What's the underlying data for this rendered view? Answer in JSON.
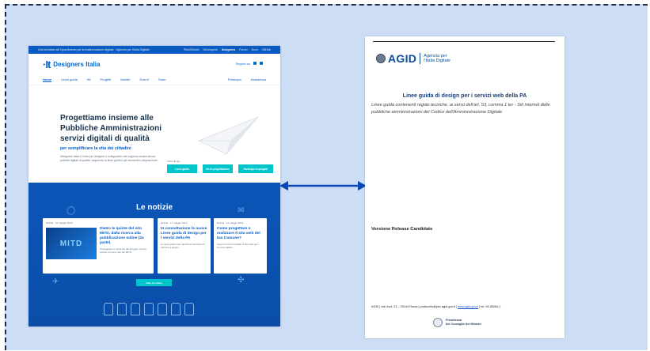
{
  "colors": {
    "background": "#cdddf5",
    "arrow": "#0a4ab8",
    "brand_blue": "#0066cc",
    "news_blue": "#0b56b8",
    "cta_teal": "#00c5ca",
    "agid_blue": "#0a4d9c"
  },
  "site": {
    "topbar_left": "Una iniziativa del Dipartimento per la trasformazione digitale · Agenzia per l'Italia Digitale",
    "topbar_links": [
      {
        "label": "Plus/Stream",
        "active": false
      },
      {
        "label": "Developers",
        "active": false
      },
      {
        "label": "Designers",
        "active": true
      },
      {
        "label": "Forum",
        "active": false
      },
      {
        "label": "Docs",
        "active": false
      },
      {
        "label": "GitHub",
        "active": false
      }
    ],
    "logo_mark": "·It",
    "logo_name": "Designers Italia",
    "social_label": "Seguici su",
    "nav": [
      {
        "label": "Home",
        "active": true
      },
      {
        "label": "Linee guida",
        "active": false
      },
      {
        "label": "Kit",
        "active": false
      },
      {
        "label": "Progetti",
        "active": false
      },
      {
        "label": "Notizie",
        "active": false
      },
      {
        "label": "Eventi",
        "active": false
      },
      {
        "label": "Team",
        "active": false
      }
    ],
    "nav_right": [
      "Partecipa",
      "Assistenza"
    ],
    "hero": {
      "title": "Progettiamo insieme alle Pubbliche Amministrazioni servizi digitali di qualità",
      "subtitle": "per semplificare la vita dei cittadini",
      "text": "Designers Italia è il sito per designer e sviluppatori che vogliono creare servizi pubblici digitali di qualità, seguendo le linee guida e gli strumenti a disposizione.",
      "cta_label": "Inizia da qui",
      "ctas": [
        "Linee guida",
        "Kit di progettazione",
        "Partecipa ai progetti"
      ]
    },
    "news": {
      "title": "Le notizie",
      "cards": [
        {
          "category": "Notizia",
          "date": "21 maggio 2019",
          "title": "Dietro le quinte del sito MITD, dalla ricerca alla pubblicazione online (2a parte)",
          "text": "Proseguiamo il racconto del progetto che ha portato al nuovo sito del MITD.",
          "image_text": "MITD"
        },
        {
          "category": "Notizia",
          "date": "17 maggio 2019",
          "title": "In consultazione le nuove Linee guida di design per i servizi della PA",
          "text": "Le linee guida sono aperte al contributo di tutti fino a giugno."
        },
        {
          "category": "Notizia",
          "date": "14 maggio 2019",
          "title": "Come progettare e realizzare il sito web del tuo Comune?",
          "text": "Scopri il nuovo modello di sito web per i Comuni italiani."
        }
      ],
      "all_news": "Tutte le notizie"
    }
  },
  "doc": {
    "agid_word": "AGID",
    "agid_sub_1": "Agenzia per",
    "agid_sub_2": "l'Italia Digitale",
    "title": "Linee guida di design per i servizi web della PA",
    "description": "Linee guida contenenti regole tecniche, ai sensi dell'art. 53, comma 1 ter - Siti internet delle pubbliche amministrazioni del Codice dell'Amministrazione Digitale",
    "version": "Versione Release Candidate",
    "footer_pre": "AGID | via Liszt, 21 – 00144 Roma | protocollo@pec.agid.gov.it | ",
    "footer_link": "www.agid.gov.it",
    "footer_post": " | tel. 06 85264.1",
    "pres_1": "Presidenza",
    "pres_2": "del Consiglio dei Ministri"
  }
}
